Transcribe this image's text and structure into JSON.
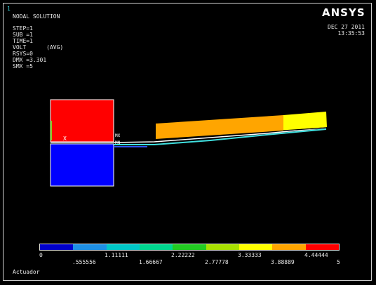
{
  "window_number": "1",
  "plot_title": "NODAL SOLUTION",
  "info_lines": [
    "STEP=1",
    "SUB =1",
    "TIME=1",
    "VOLT      (AVG)",
    "RSYS=0",
    "DMX =3.301",
    "SMX =5"
  ],
  "logo": "ANSYS",
  "date": "DEC 27 2011",
  "time": "13:35:53",
  "legend": {
    "colors": [
      "#0000cc",
      "#1e90e6",
      "#00c8c8",
      "#00d890",
      "#22cc22",
      "#a8e000",
      "#ffff00",
      "#ffa500",
      "#ff0000"
    ],
    "top_labels": [
      "0",
      "1.11111",
      "2.22222",
      "3.33333",
      "4.44444"
    ],
    "bottom_labels": [
      ".555556",
      "1.66667",
      "2.77778",
      "3.88889",
      "5"
    ]
  },
  "footer": "Actuador",
  "marker_x": "X",
  "marker_mx": "MX",
  "marker_mn": "MN"
}
